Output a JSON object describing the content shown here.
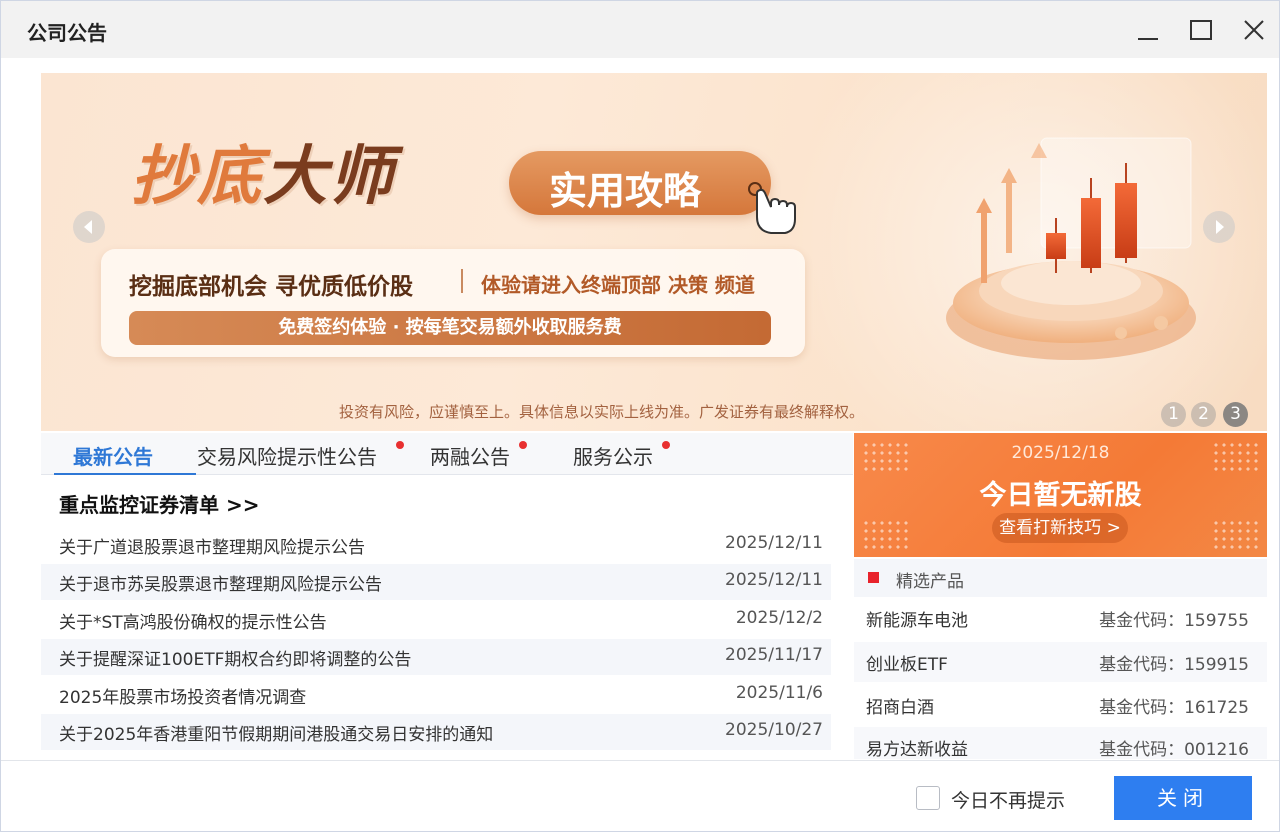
{
  "window": {
    "title": "公司公告"
  },
  "banner": {
    "headline_part1": "抄底",
    "headline_part2": "大师",
    "pill_label": "实用攻略",
    "card_main": "挖掘底部机会 寻优质低价股",
    "card_sub": "体验请进入终端顶部 决策 频道",
    "card_bar": "免费签约体验 · 按每笔交易额外收取服务费",
    "disclaimer": "投资有风险，应谨慎至上。具体信息以实际上线为准。广发证券有最终解释权。",
    "pages": [
      "1",
      "2",
      "3"
    ],
    "active_page": 3
  },
  "tabs": [
    {
      "label": "最新公告",
      "active": true,
      "has_dot": false
    },
    {
      "label": "交易风险提示性公告",
      "active": false,
      "has_dot": true
    },
    {
      "label": "两融公告",
      "active": false,
      "has_dot": true
    },
    {
      "label": "服务公示",
      "active": false,
      "has_dot": true
    }
  ],
  "section_title": "重点监控证券清单 >>",
  "notices": [
    {
      "title": "关于广道退股票退市整理期风险提示公告",
      "date": "2025/12/11"
    },
    {
      "title": "关于退市苏吴股票退市整理期风险提示公告",
      "date": "2025/12/11"
    },
    {
      "title": "关于*ST高鸿股份确权的提示性公告",
      "date": "2025/12/2"
    },
    {
      "title": "关于提醒深证100ETF期权合约即将调整的公告",
      "date": "2025/11/17"
    },
    {
      "title": "2025年股票市场投资者情况调查",
      "date": "2025/11/6"
    },
    {
      "title": "关于2025年香港重阳节假期期间港股通交易日安排的通知",
      "date": "2025/10/27"
    }
  ],
  "ipo": {
    "date": "2025/12/18",
    "title": "今日暂无新股",
    "button": "查看打新技巧 >"
  },
  "products": {
    "header": "精选产品",
    "items": [
      {
        "name": "新能源车电池",
        "code": "基金代码：159755"
      },
      {
        "name": "创业板ETF",
        "code": "基金代码：159915"
      },
      {
        "name": "招商白酒",
        "code": "基金代码：161725"
      },
      {
        "name": "易方达新收益",
        "code": "基金代码：001216"
      }
    ]
  },
  "footer": {
    "checkbox_label": "今日不再提示",
    "checkbox_checked": false,
    "close_label": "关闭"
  },
  "colors": {
    "accent_blue": "#2e7ef0",
    "tab_active": "#2f78d6",
    "ipo_orange": "#f47a36",
    "red_dot": "#e83030"
  }
}
